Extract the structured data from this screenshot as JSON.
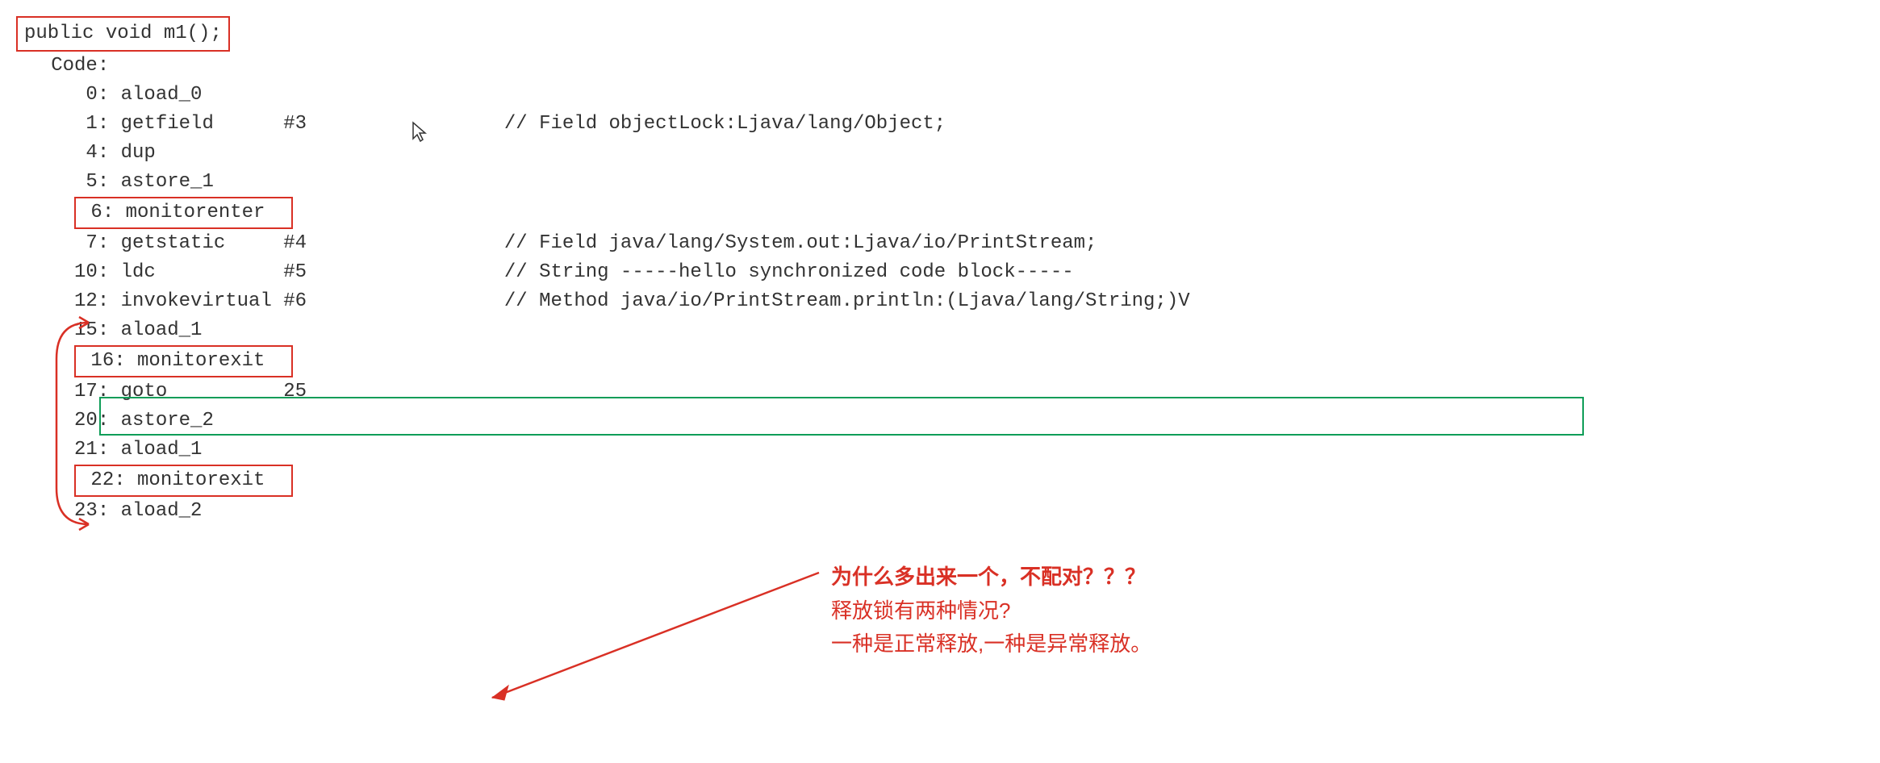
{
  "method_signature": "public void m1();",
  "code_label": "   Code:",
  "lines": {
    "l0": "      0: aload_0",
    "l1_pre": "      1: getfield      #3",
    "l1_comment": "                 // Field objectLock:Ljava/lang/Object;",
    "l4": "      4: dup",
    "l5": "      5: astore_1",
    "l6": " 6: monitorenter  ",
    "l7_pre": "      7: getstatic     #4",
    "l7_comment": "                 // Field java/lang/System.out:Ljava/io/PrintStream;",
    "l10_pre": "     10: ldc           #5",
    "l10_comment": "                 // String -----hello synchronized code block-----",
    "l12_pre": "     12: invokevirtual #6",
    "l12_comment": "                 // Method java/io/PrintStream.println:(Ljava/lang/String;)V",
    "l15": "     15: aload_1",
    "l16": " 16: monitorexit  ",
    "l17": "     17: goto          25",
    "l20": "     20: astore_2",
    "l21": "     21: aload_1",
    "l22": " 22: monitorexit  ",
    "l23": "     23: aload_2"
  },
  "annotations": {
    "q1": "为什么多出来一个，不配对？？？",
    "q2": "释放锁有两种情况?",
    "q3": "一种是正常释放,一种是异常释放。"
  }
}
